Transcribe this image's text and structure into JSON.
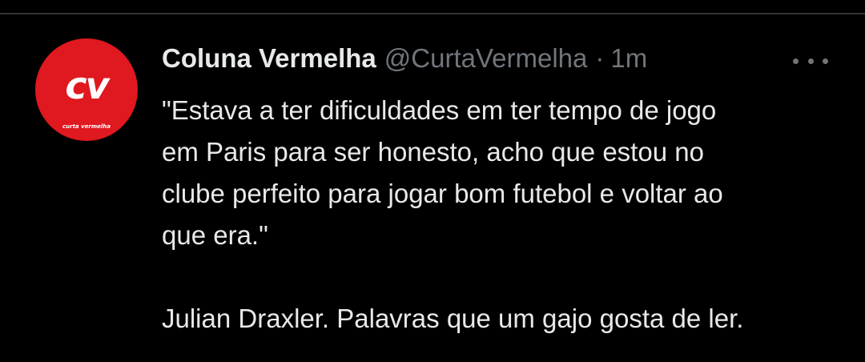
{
  "tweet": {
    "author": {
      "display_name": "Coluna Vermelha",
      "handle": "@CurtaVermelha",
      "avatar": {
        "initials": "cv",
        "caption": "curta vermelha",
        "color": "#e0181f"
      }
    },
    "separator": "·",
    "time": "1m",
    "more_icon": "more-horizontal-icon",
    "body": {
      "lines": [
        "\"Estava a ter dificuldades em ter tempo de jogo",
        "em Paris para ser honesto, acho que estou no",
        "clube perfeito para jogar bom futebol e voltar ao",
        "que era.\"",
        "Julian Draxler. Palavras que um gajo gosta de ler."
      ]
    }
  },
  "colors": {
    "background": "#000000",
    "text": "#e7e9ea",
    "muted": "#71767b",
    "divider": "#2f3336"
  }
}
